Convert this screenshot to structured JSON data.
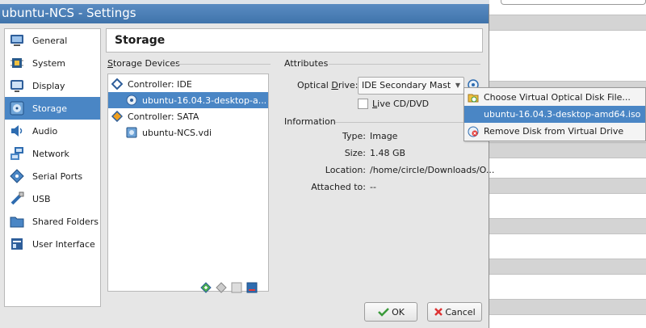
{
  "window": {
    "title": "ubuntu-NCS - Settings"
  },
  "sidebar": {
    "items": [
      {
        "label": "General",
        "icon": "monitor-icon"
      },
      {
        "label": "System",
        "icon": "chip-icon"
      },
      {
        "label": "Display",
        "icon": "display-icon"
      },
      {
        "label": "Storage",
        "icon": "storage-icon",
        "active": true
      },
      {
        "label": "Audio",
        "icon": "speaker-icon"
      },
      {
        "label": "Network",
        "icon": "network-icon"
      },
      {
        "label": "Serial Ports",
        "icon": "serial-icon"
      },
      {
        "label": "USB",
        "icon": "usb-icon"
      },
      {
        "label": "Shared Folders",
        "icon": "folder-icon"
      },
      {
        "label": "User Interface",
        "icon": "ui-icon"
      }
    ]
  },
  "header": {
    "title": "Storage"
  },
  "storage_devices": {
    "label": "Storage Devices",
    "tree": [
      {
        "label": "Controller: IDE",
        "type": "controller"
      },
      {
        "label": "ubuntu-16.04.3-desktop-a...",
        "type": "optical",
        "selected": true
      },
      {
        "label": "Controller: SATA",
        "type": "controller"
      },
      {
        "label": "ubuntu-NCS.vdi",
        "type": "disk"
      }
    ]
  },
  "attributes": {
    "label": "Attributes",
    "optical_drive_label_prefix": "Optical ",
    "optical_drive_label_accel": "D",
    "optical_drive_label_suffix": "rive:",
    "optical_drive_value": "IDE Secondary Mast",
    "live_cd_accel": "L",
    "live_cd_rest": "ive CD/DVD"
  },
  "information": {
    "label": "Information",
    "rows": [
      {
        "key": "Type:",
        "value": "Image"
      },
      {
        "key": "Size:",
        "value": "1.48 GB"
      },
      {
        "key": "Location:",
        "value": "/home/circle/Downloads/O..."
      },
      {
        "key": "Attached to:",
        "value": "--"
      }
    ]
  },
  "buttons": {
    "ok": "OK",
    "cancel": "Cancel"
  },
  "menu": {
    "items": [
      {
        "label": "Choose Virtual Optical Disk File...",
        "icon": "choose-disk-icon"
      },
      {
        "label": "ubuntu-16.04.3-desktop-amd64.iso",
        "highlighted": true
      },
      {
        "label": "Remove Disk from Virtual Drive",
        "icon": "remove-disk-icon"
      }
    ]
  },
  "colors": {
    "accent": "#4a86c5",
    "titlebar": "#4a7eb5"
  }
}
